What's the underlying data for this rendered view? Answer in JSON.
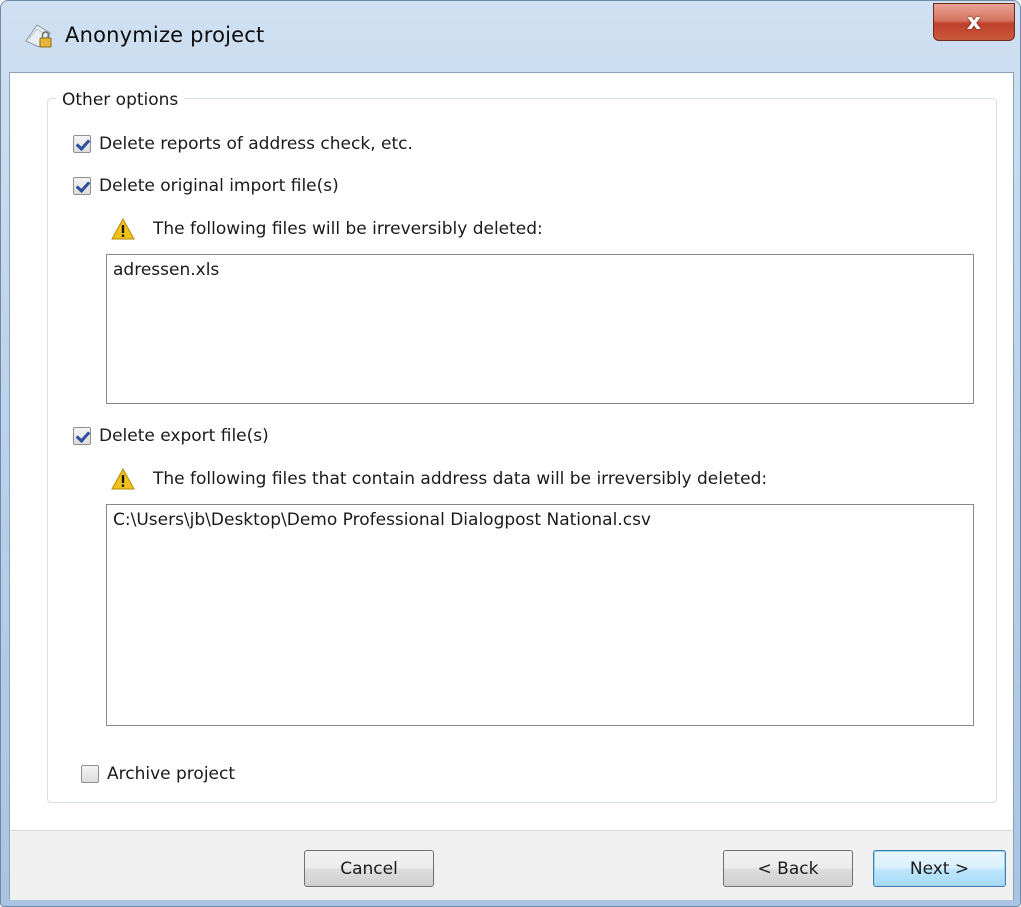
{
  "window": {
    "title": "Anonymize project",
    "close_label": "x"
  },
  "group": {
    "label": "Other options"
  },
  "options": {
    "delete_reports": {
      "label": "Delete reports of address check, etc.",
      "checked": true
    },
    "delete_import": {
      "label": "Delete original import file(s)",
      "checked": true
    },
    "delete_export": {
      "label": "Delete export file(s)",
      "checked": true
    },
    "archive_project": {
      "label": "Archive project",
      "checked": false
    }
  },
  "import_files": {
    "warning": "The following files will be irreversibly deleted:",
    "files": [
      "adressen.xls"
    ]
  },
  "export_files": {
    "warning": "The following files that contain address data will be irreversibly deleted:",
    "files": [
      "C:\\Users\\jb\\Desktop\\Demo Professional Dialogpost National.csv"
    ]
  },
  "footer": {
    "cancel_label": "Cancel",
    "back_label": "< Back",
    "next_label": "Next >"
  },
  "colors": {
    "warning": "#f2c21b",
    "check": "#2d4e9d",
    "default_button_border": "#3c7fb1"
  }
}
